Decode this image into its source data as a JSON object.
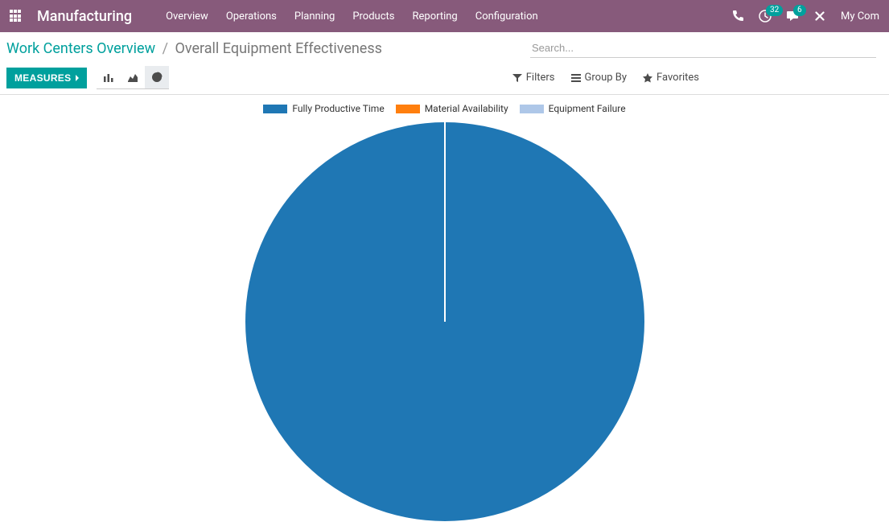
{
  "navbar": {
    "brand": "Manufacturing",
    "menu": [
      "Overview",
      "Operations",
      "Planning",
      "Products",
      "Reporting",
      "Configuration"
    ],
    "badge_activities": "32",
    "badge_messages": "6",
    "company": "My Com"
  },
  "breadcrumb": {
    "parent": "Work Centers Overview",
    "current": "Overall Equipment Effectiveness"
  },
  "search": {
    "placeholder": "Search..."
  },
  "toolbar": {
    "measures_label": "MEASURES"
  },
  "search_options": {
    "filters": "Filters",
    "group_by": "Group By",
    "favorites": "Favorites"
  },
  "legend": {
    "items": [
      {
        "label": "Fully Productive Time",
        "color": "#1f77b4"
      },
      {
        "label": "Material Availability",
        "color": "#ff7f0e"
      },
      {
        "label": "Equipment Failure",
        "color": "#aec7e8"
      }
    ]
  },
  "chart_data": {
    "type": "pie",
    "title": "",
    "series": [
      {
        "name": "Fully Productive Time",
        "value": 100,
        "color": "#1f77b4"
      },
      {
        "name": "Material Availability",
        "value": 0,
        "color": "#ff7f0e"
      },
      {
        "name": "Equipment Failure",
        "value": 0,
        "color": "#aec7e8"
      }
    ]
  }
}
